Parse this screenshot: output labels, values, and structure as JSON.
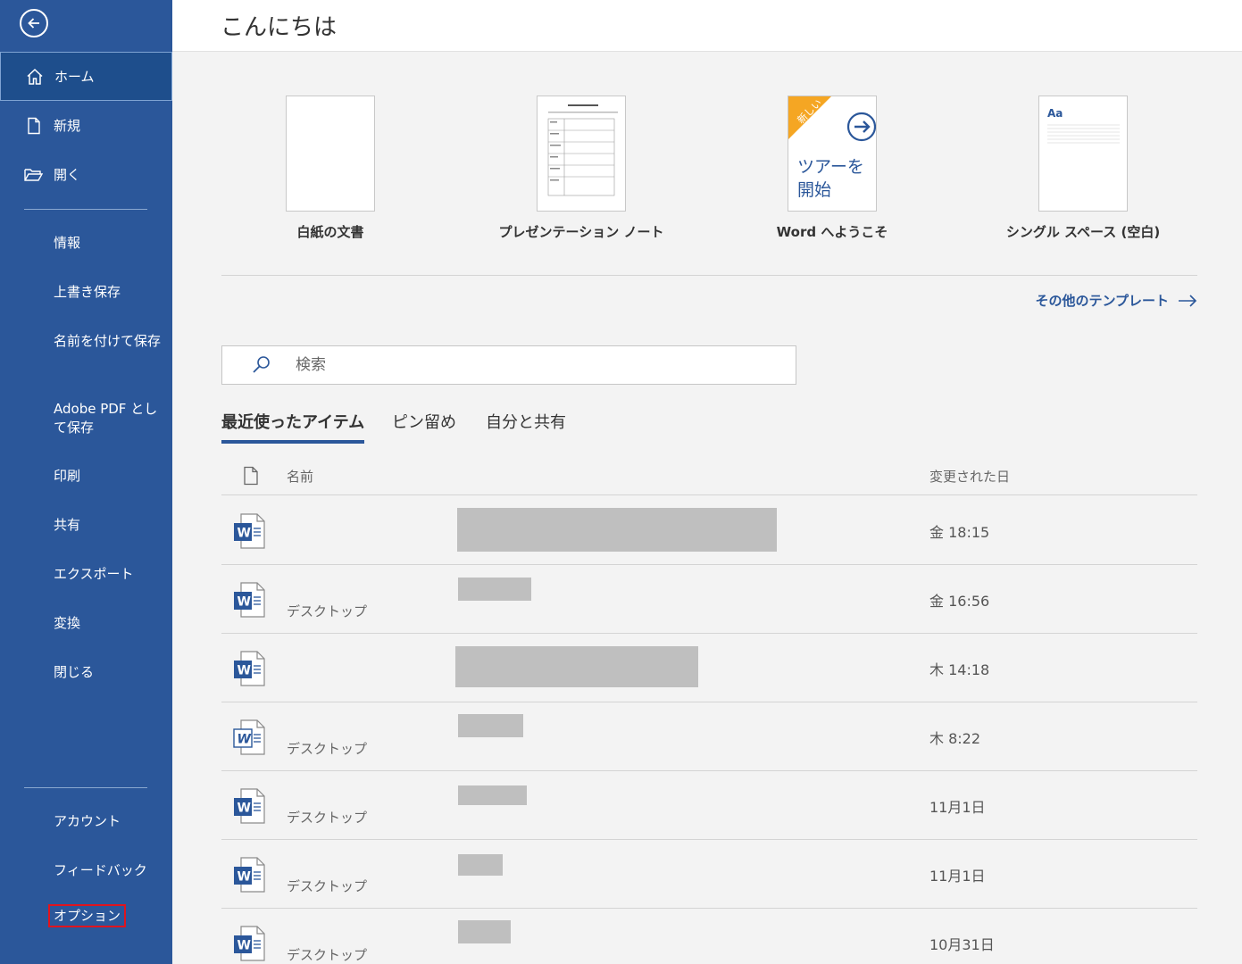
{
  "sidebar": {
    "back": "back-arrow",
    "home": "ホーム",
    "new": "新規",
    "open": "開く",
    "info": "情報",
    "save": "上書き保存",
    "save_as": "名前を付けて保存",
    "save_pdf": "Adobe PDF として保存",
    "print": "印刷",
    "share": "共有",
    "export": "エクスポート",
    "convert": "変換",
    "close": "閉じる",
    "account": "アカウント",
    "feedback": "フィードバック",
    "options": "オプション",
    "accent_color": "#2b579a"
  },
  "main": {
    "greeting": "こんにちは",
    "templates": [
      {
        "label": "白紙の文書"
      },
      {
        "label": "プレゼンテーション ノート",
        "thumb_title": "プレゼンテーション ノート"
      },
      {
        "label": "Word へようこそ",
        "badge": "新しい",
        "thumb_text_1": "ツアーを",
        "thumb_text_2": "開始"
      },
      {
        "label": "シングル スペース (空白)",
        "thumb_text": "Aa"
      }
    ],
    "more_templates": "その他のテンプレート",
    "search_placeholder": "検索",
    "tabs": [
      "最近使ったアイテム",
      "ピン留め",
      "自分と共有"
    ],
    "columns": {
      "name": "名前",
      "modified": "変更された日"
    },
    "files": [
      {
        "location": "",
        "date": "金 18:15"
      },
      {
        "location": "デスクトップ",
        "date": "金 16:56"
      },
      {
        "location": "",
        "date": "木 14:18"
      },
      {
        "location": "デスクトップ",
        "date": "木 8:22"
      },
      {
        "location": "デスクトップ",
        "date": "11月1日"
      },
      {
        "location": "デスクトップ",
        "date": "11月1日"
      },
      {
        "location": "デスクトップ",
        "date": "10月31日"
      }
    ]
  }
}
